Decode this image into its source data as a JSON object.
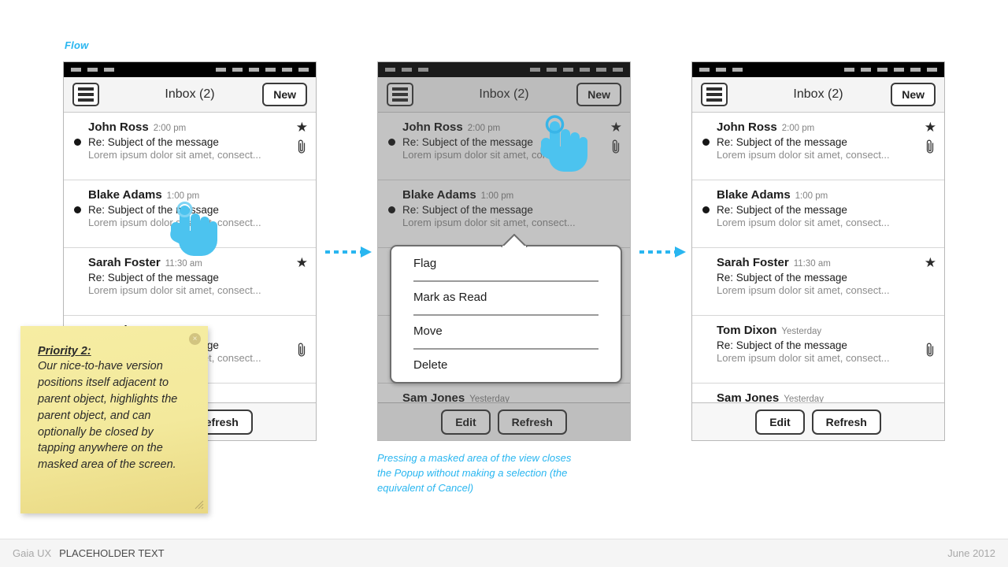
{
  "flow_label": "Flow",
  "statusbar": {
    "left_dashes": 3,
    "right_dashes": 6
  },
  "header": {
    "menu_icon": "hamburger-menu-icon",
    "title": "Inbox (2)",
    "new_label": "New"
  },
  "messages": [
    {
      "sender": "John Ross",
      "time": "2:00 pm",
      "subject": "Re: Subject of the message",
      "preview": "Lorem ipsum dolor sit amet, consect...",
      "unread": true,
      "starred": true,
      "attachment": true
    },
    {
      "sender": "Blake Adams",
      "time": "1:00 pm",
      "subject": "Re: Subject of the message",
      "preview": "Lorem ipsum dolor sit amet, consect...",
      "unread": true,
      "starred": false,
      "attachment": false
    },
    {
      "sender": "Sarah Foster",
      "time": "11:30 am",
      "subject": "Re: Subject of the message",
      "preview": "Lorem ipsum dolor sit amet, consect...",
      "unread": false,
      "starred": true,
      "attachment": false
    },
    {
      "sender": "Tom Dixon",
      "time": "Yesterday",
      "subject": "Re: Subject of the message",
      "preview": "Lorem ipsum dolor sit amet, consect...",
      "unread": false,
      "starred": false,
      "attachment": true
    },
    {
      "sender": "Sam Jones",
      "time": "Yesterday",
      "subject": "Re: Subject of the message",
      "preview": "Lorem ipsum dolor sit amet, consect...",
      "unread": false,
      "starred": false,
      "attachment": false
    }
  ],
  "toolbar": {
    "edit_label": "Edit",
    "refresh_label": "Refresh"
  },
  "popup": {
    "items": [
      {
        "label": "Flag"
      },
      {
        "label": "Mark as Read"
      },
      {
        "label": "Move"
      },
      {
        "label": "Delete"
      }
    ]
  },
  "caption": "Pressing a masked area of the view closes the Popup without making a selection (the equivalent of Cancel)",
  "sticky_note": {
    "title": "Priority 2:",
    "body": "Our nice-to-have version positions itself adjacent to parent object, highlights the parent object, and can optionally be closed by tapping anywhere on the masked area of the screen.",
    "close_glyph": "×"
  },
  "footer": {
    "left": "Gaia UX",
    "middle": "PLACEHOLDER TEXT",
    "right": "June 2012"
  },
  "colors": {
    "accent_cyan": "#29b6f0",
    "hand_blue": "#4cc3ef",
    "sticky_yellow": "#f3e99c",
    "mask_gray": "rgba(80,80,80,0.34)"
  }
}
